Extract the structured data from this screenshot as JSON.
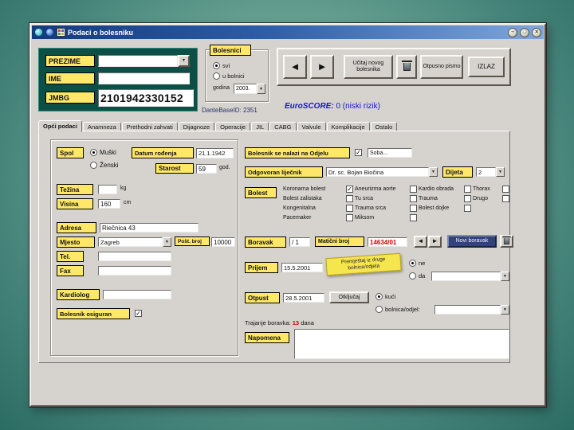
{
  "window": {
    "title": "Podaci o bolesniku",
    "minimize": "–",
    "maximize": "□",
    "close": "×"
  },
  "header": {
    "prezime_label": "PREZIME",
    "prezime_value": "",
    "ime_label": "IME",
    "ime_value": "",
    "jmbg_label": "JMBG",
    "jmbg_value": "2101942330152",
    "bolesnici": {
      "title": "Bolesnici",
      "svi": "svi",
      "u_bolnici": "u bolnici",
      "godina_label": "godina",
      "godina_value": "2003."
    },
    "database_id": "DanteBaseID: 2351",
    "euroscore_label": "EuroSCORE:",
    "euroscore_value": " 0  (niski rizik)",
    "toolbar": {
      "prev": "◄",
      "next": "►",
      "load_new": "Učitaj novog bolesnika",
      "discharge_letter": "Otpusno pismo",
      "exit": "IZLAZ"
    }
  },
  "tabs": [
    "Opći podaci",
    "Anamneza",
    "Prethodni zahvati",
    "Dijagnoze",
    "Operacije",
    "JIL",
    "CABG",
    "Valvule",
    "Komplikacije",
    "Ostalo"
  ],
  "form": {
    "spol_label": "Spol",
    "spol_m": "Muški",
    "spol_z": "Ženski",
    "datum_rodjenja_label": "Datum rođenja",
    "datum_rodjenja_value": "21.1.1942",
    "starost_label": "Starost",
    "starost_value": "59",
    "starost_unit": "god.",
    "tezina_label": "Težina",
    "tezina_value": "",
    "tezina_unit": "kg",
    "visina_label": "Visina",
    "visina_value": "160",
    "visina_unit": "cm",
    "adresa_label": "Adresa",
    "adresa_value": "Riečnica 43",
    "mjesto_label": "Mjesto",
    "mjesto_value": "Zagreb",
    "post_broj_label": "Pošt. broj",
    "post_broj_value": "10000",
    "tel_label": "Tel.",
    "tel_value": "",
    "fax_label": "Fax",
    "fax_value": "",
    "kardiolog_label": "Kardiolog",
    "kardiolog_value": "",
    "osiguran_label": "Bolesnik osiguran"
  },
  "right": {
    "odjel_label": "Bolesnik se nalazi na Odjelu",
    "odjel_value": "Soba...",
    "lijecnik_label": "Odgovoran liječnik",
    "lijecnik_value": "Dr. sc. Bojan Biočina",
    "dijeta_label": "Dijeta",
    "dijeta_value": "2",
    "bolest_label": "Bolest",
    "bolest_columns": [
      [
        {
          "label": "Koronarna bolest",
          "checked": true
        },
        {
          "label": "Bolest zalistaka",
          "checked": false
        },
        {
          "label": "Kongenitalna",
          "checked": false
        },
        {
          "label": "Pacemaker",
          "checked": false
        }
      ],
      [
        {
          "label": "Aneurizma aorte",
          "checked": false
        },
        {
          "label": "Tu srca",
          "checked": false
        },
        {
          "label": "Trauma srca",
          "checked": false
        },
        {
          "label": "Miksom",
          "checked": false
        }
      ],
      [
        {
          "label": "Kardio obrada",
          "checked": false
        },
        {
          "label": "Trauma",
          "checked": false
        },
        {
          "label": "Bolest dojke",
          "checked": false
        }
      ],
      [
        {
          "label": "Thorax",
          "checked": false
        },
        {
          "label": "Drugo",
          "checked": false
        }
      ]
    ],
    "boravak_label": "Boravak",
    "boravak_value": "/ 1",
    "maticni_label": "Matični broj",
    "maticni_value": "14634/01",
    "nav_prev": "◄",
    "nav_next": "►",
    "novi_boravak": "Novi boravak",
    "prijem_label": "Prijem",
    "prijem_value": "15.5.2001",
    "premjestaj_note": "Premještaj iz druge bolnice/odjela",
    "radio_ne": "ne",
    "radio_da": "da",
    "premjestaj_value": "",
    "otpust_label": "Otpust",
    "otpust_value": "28.5.2001",
    "otkljucaj": "Otključaj",
    "radio_kuci": "kući",
    "radio_bolnica": "bolnica/odjel:",
    "otpust_dest_value": "",
    "trajanje_label": "Trajanje boravka:",
    "trajanje_value": "13",
    "trajanje_unit": "dana",
    "napomena_label": "Napomena",
    "napomena_value": ""
  }
}
